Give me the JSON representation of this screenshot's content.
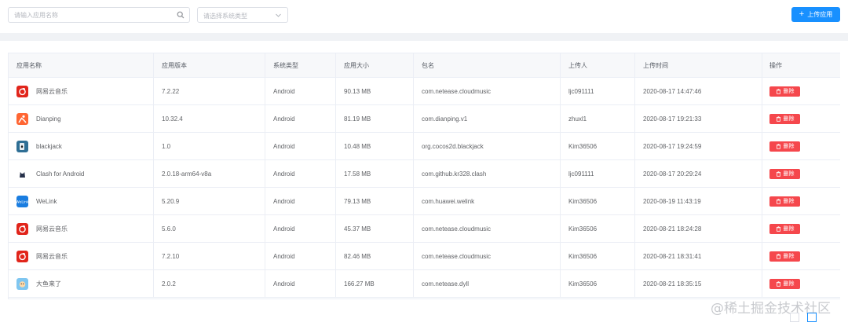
{
  "toolbar": {
    "search_placeholder": "请输入应用名称",
    "search_icon": "search-icon",
    "type_placeholder": "请选择系统类型",
    "upload_label": "上传应用",
    "accent_color": "#1890ff"
  },
  "table": {
    "columns": [
      "应用名称",
      "应用版本",
      "系统类型",
      "应用大小",
      "包名",
      "上传人",
      "上传时间",
      "操作"
    ],
    "delete_label": "删除",
    "delete_color": "#f5474c",
    "rows": [
      {
        "icon": "netease-music-icon",
        "name": "网易云音乐",
        "version": "7.2.22",
        "os": "Android",
        "size": "90.13 MB",
        "package": "com.netease.cloudmusic",
        "uploader": "ljc091111",
        "time": "2020-08-17 14:47:46"
      },
      {
        "icon": "dianping-icon",
        "name": "Dianping",
        "version": "10.32.4",
        "os": "Android",
        "size": "81.19 MB",
        "package": "com.dianping.v1",
        "uploader": "zhuxl1",
        "time": "2020-08-17 19:21:33"
      },
      {
        "icon": "blackjack-icon",
        "name": "blackjack",
        "version": "1.0",
        "os": "Android",
        "size": "10.48 MB",
        "package": "org.cocos2d.blackjack",
        "uploader": "Kim36506",
        "time": "2020-08-17 19:24:59"
      },
      {
        "icon": "clash-icon",
        "name": "Clash for Android",
        "version": "2.0.18-arm64-v8a",
        "os": "Android",
        "size": "17.58 MB",
        "package": "com.github.kr328.clash",
        "uploader": "ljc091111",
        "time": "2020-08-17 20:29:24"
      },
      {
        "icon": "welink-icon",
        "name": "WeLink",
        "version": "5.20.9",
        "os": "Android",
        "size": "79.13 MB",
        "package": "com.huawei.welink",
        "uploader": "Kim36506",
        "time": "2020-08-19 11:43:19"
      },
      {
        "icon": "netease-music-icon",
        "name": "网易云音乐",
        "version": "5.6.0",
        "os": "Android",
        "size": "45.37 MB",
        "package": "com.netease.cloudmusic",
        "uploader": "Kim36506",
        "time": "2020-08-21 18:24:28"
      },
      {
        "icon": "netease-music-icon",
        "name": "网易云音乐",
        "version": "7.2.10",
        "os": "Android",
        "size": "82.46 MB",
        "package": "com.netease.cloudmusic",
        "uploader": "Kim36506",
        "time": "2020-08-21 18:31:41"
      },
      {
        "icon": "dayu-icon",
        "name": "大鱼来了",
        "version": "2.0.2",
        "os": "Android",
        "size": "166.27 MB",
        "package": "com.netease.dyll",
        "uploader": "Kim36506",
        "time": "2020-08-21 18:35:15"
      }
    ]
  },
  "watermark": "@稀土掘金技术社区"
}
